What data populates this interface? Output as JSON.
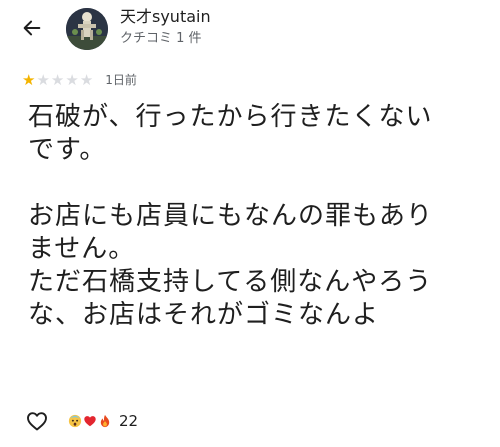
{
  "header": {
    "back_icon": "arrow-left-icon",
    "user_name": "天才syutain",
    "user_meta": "クチコミ 1 件"
  },
  "rating": {
    "value": 1,
    "max": 5,
    "date": "1日前",
    "star_color": "#f4b400",
    "star_empty_color": "#dadce0"
  },
  "review": {
    "line1": "石破が、行ったから行きたくない",
    "line2": "です。",
    "line3": "お店にも店員にもなんの罪もあり",
    "line4": "ません。",
    "line5": "ただ石橋支持してる側なんやろう",
    "line6": "な、お店はそれがゴミなんよ"
  },
  "actions": {
    "like_icon": "heart-outline-icon",
    "reaction_icons": [
      "shocked-face-icon",
      "red-heart-icon",
      "fire-icon"
    ],
    "reaction_count": "22"
  }
}
